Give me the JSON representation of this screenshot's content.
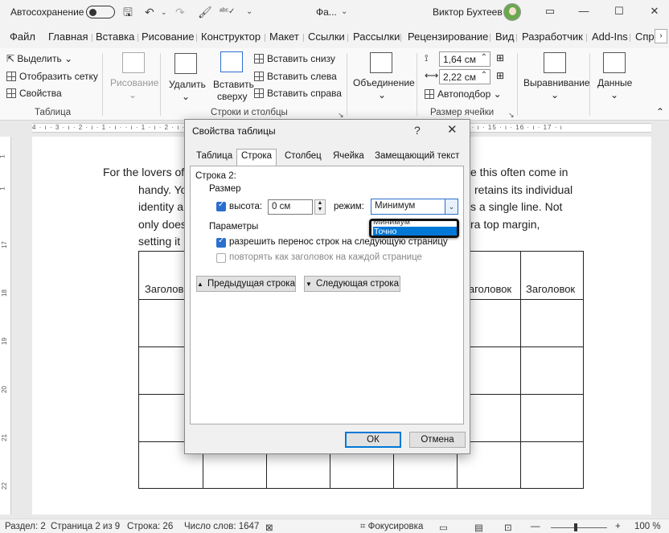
{
  "titlebar": {
    "autosave_label": "Автосохранение",
    "doc_name": "Фа...",
    "user_name": "Виктор Бухтеев",
    "icons": [
      "save-icon",
      "undo-icon",
      "redo-icon",
      "format-painter-icon",
      "spelling-icon",
      "dropdown-icon"
    ]
  },
  "menu": {
    "items": [
      "Файл",
      "Главная",
      "Вставка",
      "Рисование",
      "Конструктор",
      "Макет",
      "Ссылки",
      "Рассылки",
      "Рецензирование",
      "Вид",
      "Разработчик",
      "Add-Ins",
      "Спр"
    ]
  },
  "ribbon": {
    "select": "Выделить",
    "gridlines": "Отобразить сетку",
    "properties": "Свойства",
    "table_group": "Таблица",
    "draw": "Рисование",
    "delete": "Удалить",
    "insert_above_1": "Вставить",
    "insert_above_2": "сверху",
    "insert_below": "Вставить снизу",
    "insert_left": "Вставить слева",
    "insert_right": "Вставить справа",
    "rows_cols_group": "Строки и столбцы",
    "merge": "Объединение",
    "height_value": "1,64 см",
    "width_value": "2,22 см",
    "autofit": "Автоподбор",
    "cell_size_group": "Размер ячейки",
    "alignment": "Выравнивание",
    "data": "Данные"
  },
  "ruler": {
    "text": "4 · ı · 3 · ı · 2 · ı · 1 · ı ·   · ı · 1 · ı · 2 · ı · 3 · ı · 4 · ı · 5 · ı · 6 · ı · 7 · ı · 8 · ı · 9 · ı · 10 · ı · 11 · ı · 12 · ı · 13 · ı · 14 · ı · 15 · ı · 16 · ı · 17 · ı"
  },
  "document": {
    "line1_left": "For the lovers of",
    "line1_right": "e this often come in",
    "line2_left": "handy. Yo",
    "line2_right": "retains its individual",
    "line3_left": "identity a",
    "line3_right": "s a single line. Not",
    "line4_left": "only does",
    "line4_right": "ra top margin,",
    "line5_left": "setting it",
    "table_headers": [
      "Заголов",
      "Заголовок",
      "Заголовок"
    ]
  },
  "status": {
    "section": "Раздел: 2",
    "page": "Страница 2 из 9",
    "line": "Строка: 26",
    "words": "Число слов: 1647",
    "focus": "Фокусировка",
    "zoom": "100 %"
  },
  "dialog": {
    "title": "Свойства таблицы",
    "help": "?",
    "close": "✕",
    "tabs": [
      "Таблица",
      "Строка",
      "Столбец",
      "Ячейка",
      "Замещающий текст"
    ],
    "active_tab": 1,
    "row_label": "Строка 2:",
    "size_label": "Размер",
    "height_label": "высота:",
    "height_value": "0 см",
    "mode_label": "режим:",
    "mode_value": "Минимум",
    "dropdown_options": [
      "Минимум",
      "Точно"
    ],
    "params_label": "Параметры",
    "allow_break": "разрешить перенос строк на следующую страницу",
    "repeat_header": "повторять как заголовок на каждой странице",
    "prev_row": "Предыдущая строка",
    "next_row": "Следующая строка",
    "ok": "ОК",
    "cancel": "Отмена"
  }
}
